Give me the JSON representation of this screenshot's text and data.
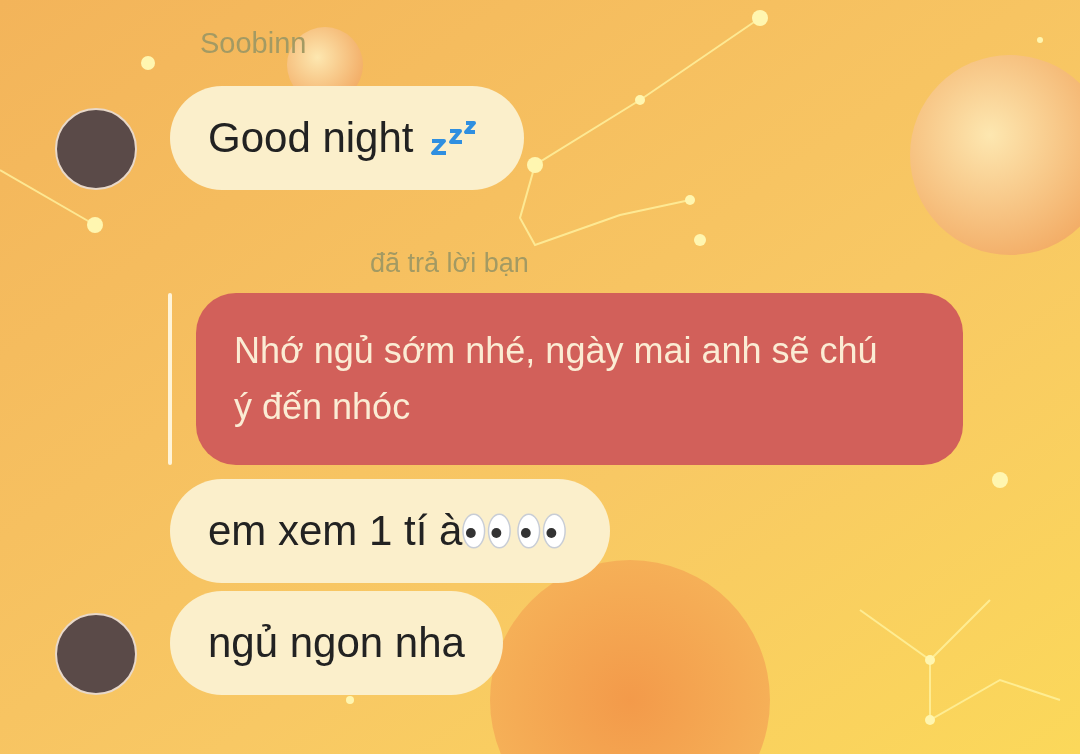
{
  "messages": [
    {
      "kind": "sleep-emoji",
      "sender_name": "Soobinn",
      "text": "Good night",
      "avatar": true
    },
    {
      "kind": "reply",
      "reply_label": "đã trả lời bạn",
      "text": "Nhớ ngủ sớm nhé, ngày mai anh sẽ chú ý đến nhóc"
    },
    {
      "kind": "eyes-emoji",
      "text": "em xem 1 tí à",
      "avatar": false
    },
    {
      "kind": "text",
      "text": "ngủ ngon nha",
      "avatar": true
    }
  ]
}
